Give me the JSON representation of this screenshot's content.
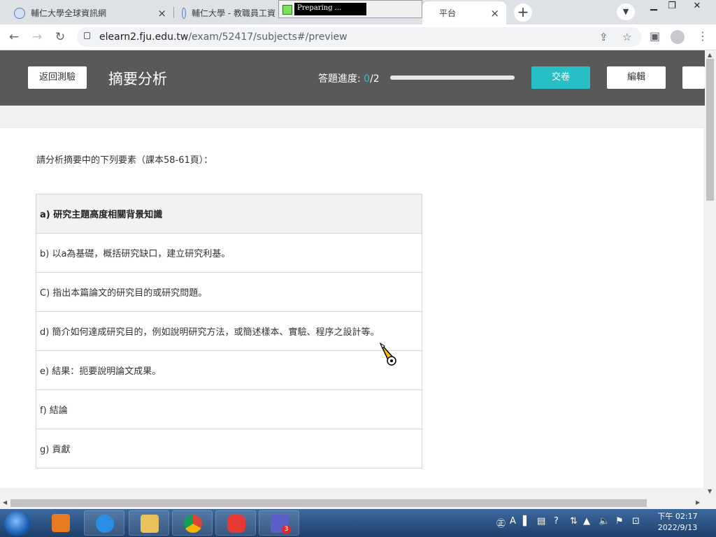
{
  "browser": {
    "tabs": [
      {
        "title": "輔仁大學全球資訊網",
        "close": "×"
      },
      {
        "title": "輔仁大學 - 教職員工資"
      },
      {
        "title": "平台",
        "close": "×"
      }
    ],
    "new_tab": "+",
    "overlay_text": "Preparing ...",
    "url_host": "elearn2.fju.edu.tw",
    "url_path": "/exam/52417/subjects#/preview"
  },
  "header": {
    "back_button": "返回測驗",
    "title": "摘要分析",
    "progress_label": "答題進度:",
    "progress_done": "0",
    "progress_total": "/2",
    "progress_fraction": 0,
    "submit_button": "交卷",
    "edit_button": "編輯"
  },
  "content": {
    "instruction": "請分析摘要中的下列要素（課本58-61頁）：",
    "rows": [
      "a) 研究主題高度相關背景知識",
      "b) 以a為基礎，概括研究缺口，建立研究利基。",
      "C) 指出本篇論文的研究目的或研究問題。",
      "d) 簡介如何達成研究目的，例如說明研究方法，或簡述樣本、實驗、程序之設計等。",
      "e) 結果：扼要說明論文成果。",
      "f) 結論",
      "g) 貢獻"
    ]
  },
  "taskbar": {
    "time": "下午 02:17",
    "date": "2022/9/13",
    "teams_badge": "3"
  },
  "colors": {
    "header_bg": "#595959",
    "accent_teal": "#26bfc6"
  }
}
